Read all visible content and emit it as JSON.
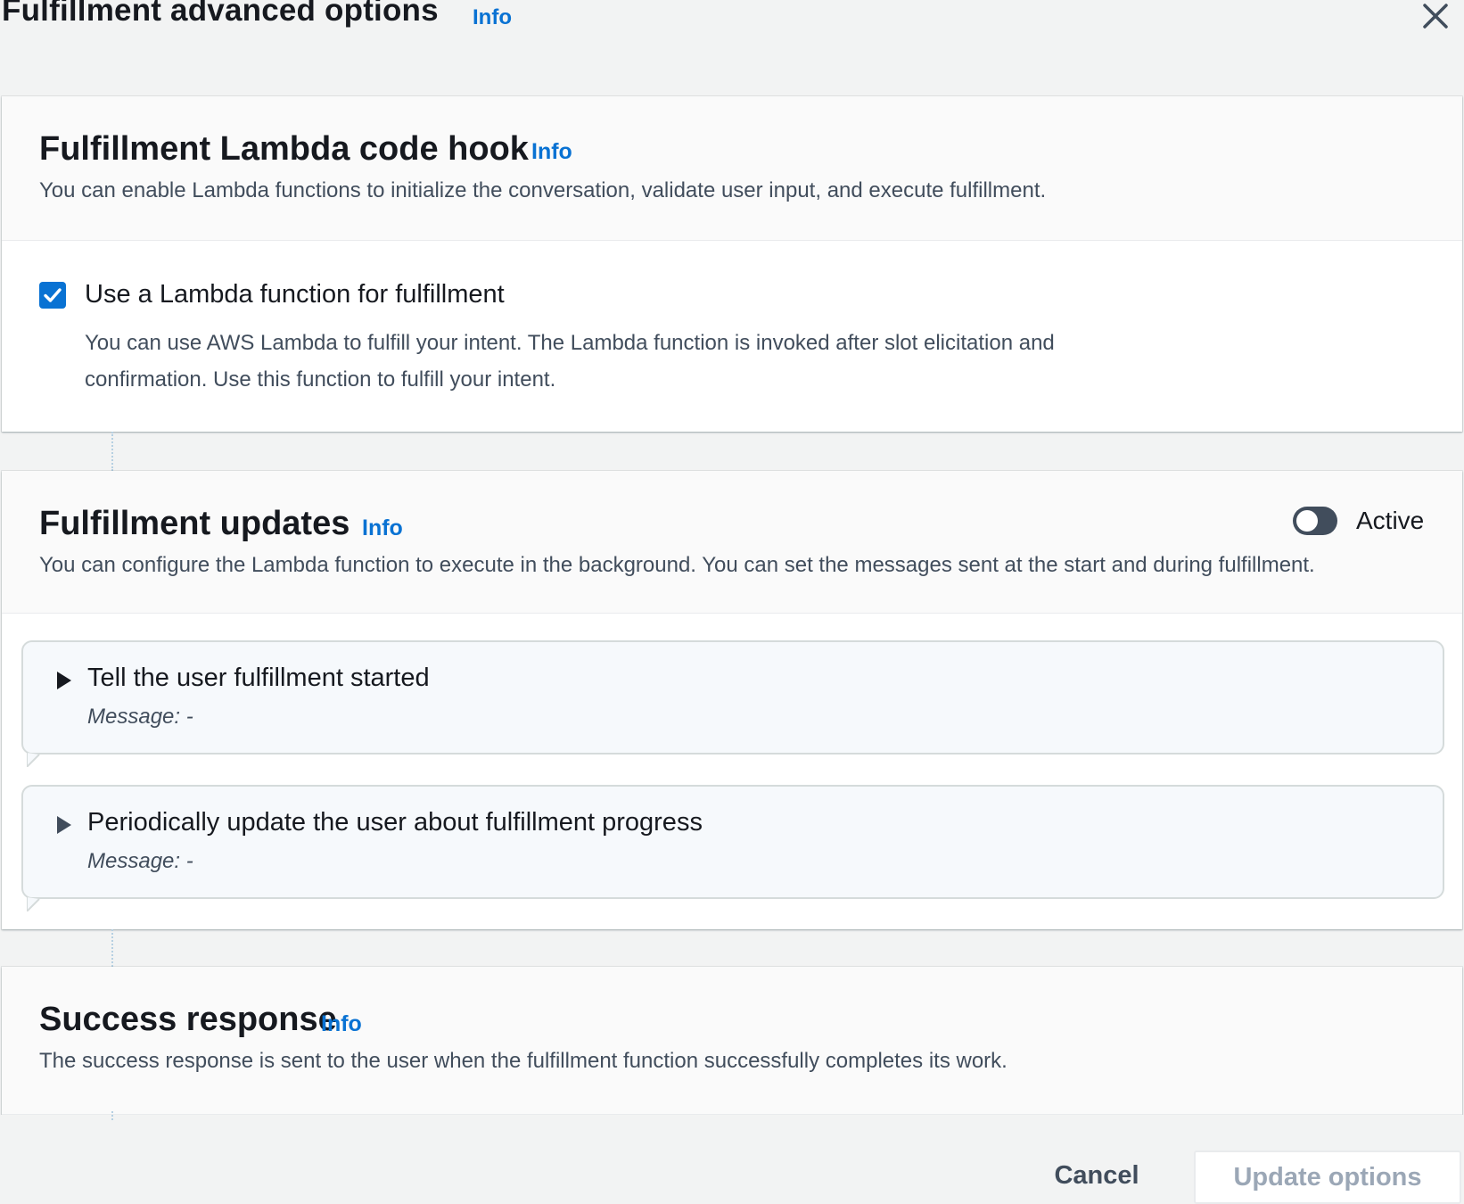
{
  "header": {
    "title": "Fulfillment advanced options",
    "info": "Info"
  },
  "lambda_hook": {
    "title": "Fulfillment Lambda code hook",
    "info": "Info",
    "description": "You can enable Lambda functions to initialize the conversation, validate user input, and execute fulfillment.",
    "checkbox_label": "Use a Lambda function for fulfillment",
    "checkbox_checked": true,
    "checkbox_description": "You can use AWS Lambda to fulfill your intent. The Lambda function is invoked after slot elicitation and confirmation. Use this function to fulfill your intent."
  },
  "updates": {
    "title": "Fulfillment updates",
    "info": "Info",
    "description": "You can configure the Lambda function to execute in the background. You can set the messages sent at the start and during fulfillment.",
    "toggle_label": "Active",
    "toggle_on": false,
    "messages": [
      {
        "title": "Tell the user fulfillment started",
        "subtitle": "Message: -"
      },
      {
        "title": "Periodically update the user about fulfillment progress",
        "subtitle": "Message: -"
      }
    ]
  },
  "success": {
    "title": "Success response",
    "info": "Info",
    "description": "The success response is sent to the user when the fulfillment function successfully completes its work."
  },
  "footer": {
    "cancel_label": "Cancel",
    "update_label": "Update options"
  },
  "colors": {
    "accent": "#0972d3",
    "disabled_text": "#9ba7b6"
  }
}
